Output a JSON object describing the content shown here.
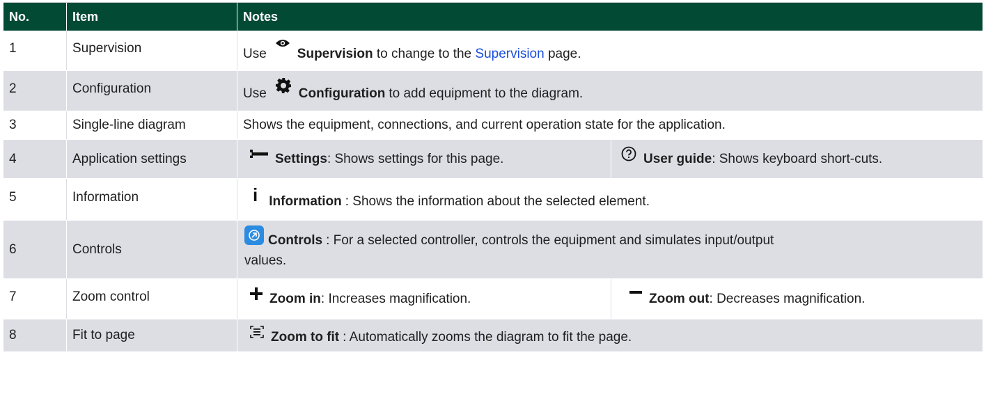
{
  "header": {
    "no": "No.",
    "item": "Item",
    "notes": "Notes"
  },
  "colors": {
    "header_bg": "#034a35",
    "row_alt": "#dcdee4",
    "link": "#1a4fdc",
    "controls_icon": "#2b8be0"
  },
  "rows": [
    {
      "no": "1",
      "item": "Supervision",
      "n1_pre": "Use",
      "n1_bold": "Supervision",
      "n1_mid": " to change to the ",
      "n1_link": "Supervision",
      "n1_post": " page.",
      "icon": "eye-icon"
    },
    {
      "no": "2",
      "item": "Configuration",
      "n1_pre": "Use",
      "n1_bold": "Configuration",
      "n1_post": "to add equipment to the diagram.",
      "icon": "gear-icon"
    },
    {
      "no": "3",
      "item": "Single-line diagram",
      "n1_post": "Shows the equipment, connections, and current operation state for the application."
    },
    {
      "no": "4",
      "item": "Application settings",
      "n1_bold": "Settings",
      "n1_post": ": Shows settings for this page.",
      "icon": "wrench-icon",
      "n2_bold": "User guide",
      "n2_post": ": Shows keyboard short-cuts.",
      "icon2": "help-circle-icon"
    },
    {
      "no": "5",
      "item": "Information",
      "n1_bold": "Information",
      "n1_post": ": Shows the information about the selected element.",
      "icon": "info-icon"
    },
    {
      "no": "6",
      "item": "Controls",
      "n1_bold": "Controls",
      "n1_post": ": For a selected controller, controls the equipment and simulates input/output",
      "n1_line2": "values.",
      "icon": "controls-icon"
    },
    {
      "no": "7",
      "item": "Zoom control",
      "n1_bold": "Zoom in",
      "n1_post": ": Increases magnification.",
      "icon": "plus-icon",
      "n2_bold": "Zoom out",
      "n2_post": ": Decreases magnification.",
      "icon2": "minus-icon"
    },
    {
      "no": "8",
      "item": "Fit to page",
      "n1_bold": "Zoom to fit",
      "n1_post": ": Automatically zooms the diagram to fit the page.",
      "icon": "zoom-to-fit-icon"
    }
  ]
}
